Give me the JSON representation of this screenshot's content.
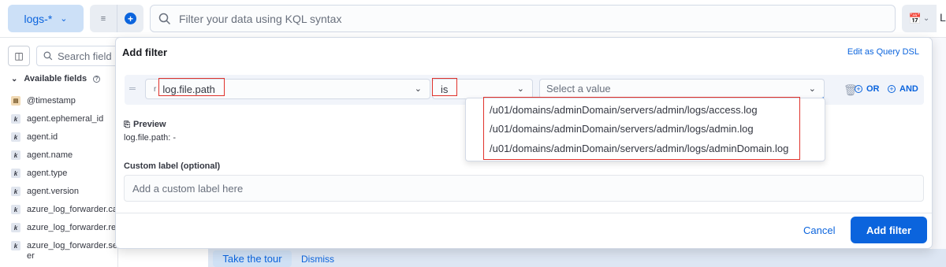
{
  "topbar": {
    "data_view": "logs-*",
    "search_placeholder": "Filter your data using KQL syntax",
    "date_letter": "L"
  },
  "sidebar": {
    "search_placeholder": "Search field n",
    "section_title": "Available fields",
    "fields": [
      {
        "name": "@timestamp",
        "type": "date"
      },
      {
        "name": "agent.ephemeral_id",
        "type": "k"
      },
      {
        "name": "agent.id",
        "type": "k"
      },
      {
        "name": "agent.name",
        "type": "k"
      },
      {
        "name": "agent.type",
        "type": "k"
      },
      {
        "name": "agent.version",
        "type": "k"
      },
      {
        "name": "azure_log_forwarder.ca",
        "type": "k"
      },
      {
        "name": "azure_log_forwarder.re",
        "type": "k"
      },
      {
        "name": "azure_log_forwarder.se",
        "type": "k"
      },
      {
        "name": "er",
        "type": ""
      }
    ]
  },
  "popover": {
    "title": "Add filter",
    "edit_dsl": "Edit as Query DSL",
    "field_prefix": "r",
    "field_value": "log.file.path",
    "operator_value": "is",
    "value_placeholder": "Select a value",
    "or_label": "OR",
    "and_label": "AND",
    "preview_title": "Preview",
    "preview_text": "log.file.path: -",
    "custom_label_title": "Custom label (optional)",
    "custom_label_placeholder": "Add a custom label here",
    "cancel_label": "Cancel",
    "submit_label": "Add filter"
  },
  "dropdown_options": [
    "/u01/domains/adminDomain/servers/admin/logs/access.log",
    "/u01/domains/adminDomain/servers/admin/logs/admin.log",
    "/u01/domains/adminDomain/servers/admin/logs/adminDomain.log"
  ],
  "tour": {
    "take_tour": "Take the tour",
    "dismiss": "Dismiss"
  },
  "colors": {
    "accent": "#0b64dd",
    "highlight": "#e0322b"
  }
}
